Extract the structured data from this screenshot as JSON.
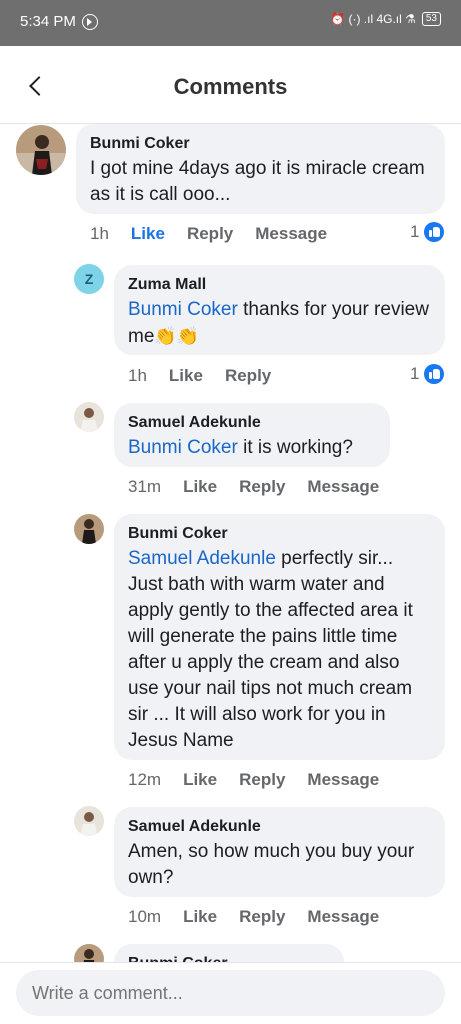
{
  "status_bar": {
    "time": "5:34 PM",
    "indicators": "⏰ (·) .ıl 4G.ıl ⚗",
    "battery": "53"
  },
  "header": {
    "title": "Comments"
  },
  "comments": [
    {
      "author": "Bunmi Coker",
      "text": "I got mine 4days ago it is miracle cream as it is call ooo...",
      "time": "1h",
      "like": "Like",
      "reply": "Reply",
      "message": "Message",
      "reactions": "1"
    },
    {
      "author": "Zuma Mall",
      "avatar_letter": "Z",
      "mention": "Bunmi Coker",
      "text": " thanks for your review me",
      "emoji": "👏👏",
      "time": "1h",
      "like": "Like",
      "reply": "Reply",
      "reactions": "1"
    },
    {
      "author": "Samuel Adekunle",
      "mention": "Bunmi Coker",
      "text": " it is working?",
      "time": "31m",
      "like": "Like",
      "reply": "Reply",
      "message": "Message"
    },
    {
      "author": "Bunmi Coker",
      "mention": "Samuel Adekunle",
      "text": " perfectly sir... Just bath with warm water and apply gently to the affected area it will generate the pains little time after u apply the cream and also use your nail tips not much cream sir ... It will also work for you in Jesus Name",
      "time": "12m",
      "like": "Like",
      "reply": "Reply",
      "message": "Message"
    },
    {
      "author": "Samuel Adekunle",
      "text": "Amen, so how much you buy your own?",
      "time": "10m",
      "like": "Like",
      "reply": "Reply",
      "message": "Message"
    },
    {
      "author": "Bunmi Coker"
    }
  ],
  "composer": {
    "placeholder": "Write a comment..."
  },
  "colors": {
    "accent": "#1a73e8",
    "mention": "#1a66c9",
    "bubble": "#f0f2f5",
    "statusbar": "#6f6f6f"
  }
}
